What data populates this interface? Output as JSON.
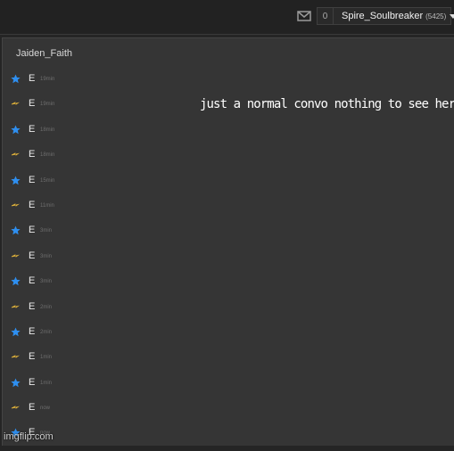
{
  "header": {
    "notifications_count": "0",
    "username": "Spire_Soulbreaker",
    "points": "(5425)"
  },
  "chat": {
    "partner_name": "Jaiden_Faith",
    "messages": [
      {
        "icon": "blue-star-icon",
        "text": "E",
        "time": "19min"
      },
      {
        "icon": "yellow-bolt-icon",
        "text": "E",
        "time": "19min"
      },
      {
        "icon": "blue-star-icon",
        "text": "E",
        "time": "18min"
      },
      {
        "icon": "yellow-bolt-icon",
        "text": "E",
        "time": "18min"
      },
      {
        "icon": "blue-star-icon",
        "text": "E",
        "time": "15min"
      },
      {
        "icon": "yellow-bolt-icon",
        "text": "E",
        "time": "11min"
      },
      {
        "icon": "blue-star-icon",
        "text": "E",
        "time": "3min"
      },
      {
        "icon": "yellow-bolt-icon",
        "text": "E",
        "time": "3min"
      },
      {
        "icon": "blue-star-icon",
        "text": "E",
        "time": "3min"
      },
      {
        "icon": "yellow-bolt-icon",
        "text": "E",
        "time": "2min"
      },
      {
        "icon": "blue-star-icon",
        "text": "E",
        "time": "2min"
      },
      {
        "icon": "yellow-bolt-icon",
        "text": "E",
        "time": "1min"
      },
      {
        "icon": "blue-star-icon",
        "text": "E",
        "time": "1min"
      },
      {
        "icon": "yellow-bolt-icon",
        "text": "E",
        "time": "now"
      },
      {
        "icon": "blue-star-icon",
        "text": "E",
        "time": "now"
      }
    ]
  },
  "overlay_caption": "just a normal convo nothing to see here",
  "watermark": "imgflip.com",
  "colors": {
    "star": "#2e8ff0",
    "bolt": "#e0b23a",
    "panel": "#353535",
    "topbar": "#222222"
  }
}
